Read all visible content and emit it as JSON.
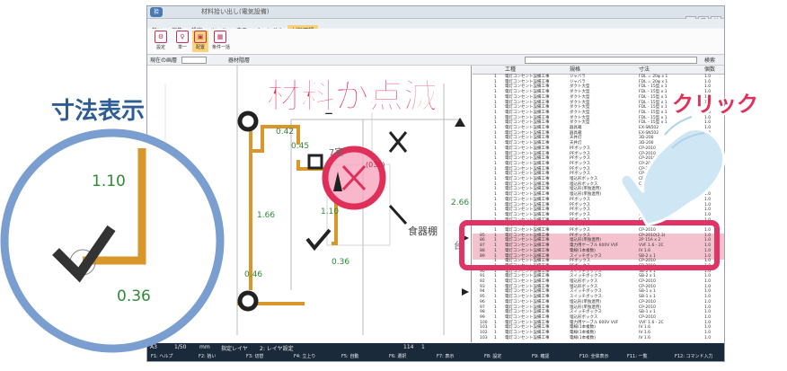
{
  "window": {
    "title": "材料拾い出し(電気設備)",
    "logo": "拾",
    "min_label": "_",
    "max_label": "□",
    "close_label": "×"
  },
  "menu": [
    "拾い",
    "編集",
    "設定",
    "ツール",
    "表示",
    "ウィンドウ",
    "材料確認"
  ],
  "ribbon": [
    {
      "label": "設定",
      "icon": "gear-icon",
      "glyph": "⚙"
    },
    {
      "label": "単一",
      "icon": "pin-icon",
      "glyph": "♀"
    },
    {
      "label": "配置",
      "icon": "place-icon",
      "glyph": "▣"
    },
    {
      "label": "条件一括",
      "icon": "filter-icon",
      "glyph": "▦"
    }
  ],
  "toolrow": {
    "layer_label": "現在の画層",
    "material_label": "器材階層",
    "search_label": "検索"
  },
  "drawing": {
    "dims": [
      "0.42",
      "0.45",
      "1.10",
      "0.36",
      "1.66",
      "0.46",
      "2.66"
    ],
    "room": "食器棚",
    "room_partial": "7室",
    "blink_label": "(030)",
    "kitchen_partial": "台"
  },
  "list": {
    "headers": [
      "工種",
      "規格",
      "寸法",
      "個数"
    ],
    "rows": [
      {
        "n": "",
        "q": "1",
        "trade": "電灯コンセント設備工事",
        "spec": "ジャバラ",
        "size": "FDL = 20φ x 1",
        "qty": "1.0",
        "hl": false
      },
      {
        "n": "",
        "q": "1",
        "trade": "電灯コンセント設備工事",
        "spec": "ジャバラ",
        "size": "FDL = 20φ x 1",
        "qty": "1.0",
        "hl": false
      },
      {
        "n": "",
        "q": "1",
        "trade": "電灯コンセント設備工事",
        "spec": "ダクト大型",
        "size": "FDL - 15型 x 1",
        "qty": "1.0",
        "hl": false
      },
      {
        "n": "",
        "q": "1",
        "trade": "電灯コンセント設備工事",
        "spec": "ダクト大型",
        "size": "FDL - 15型 x 1",
        "qty": "1.0",
        "hl": false
      },
      {
        "n": "",
        "q": "1",
        "trade": "電灯コンセント設備工事",
        "spec": "ダクト大型",
        "size": "FDL - 15型 x 1",
        "qty": "1.0",
        "hl": false
      },
      {
        "n": "",
        "q": "1",
        "trade": "電灯コンセント設備工事",
        "spec": "ダクト大型",
        "size": "FDL - 15型 x 1",
        "qty": "1.0",
        "hl": false
      },
      {
        "n": "",
        "q": "1",
        "trade": "電灯コンセント設備工事",
        "spec": "ダクト大型",
        "size": "FDL - 15型 x 1",
        "qty": "1.0",
        "hl": false
      },
      {
        "n": "",
        "q": "1",
        "trade": "電灯コンセント設備工事",
        "spec": "ダクト大型",
        "size": "FDL - 15型 x 1",
        "qty": "1.0",
        "hl": false
      },
      {
        "n": "",
        "q": "1",
        "trade": "電灯コンセント設備工事",
        "spec": "ダクト大型",
        "size": "FDL - 15型 x 1",
        "qty": "1.0",
        "hl": false
      },
      {
        "n": "",
        "q": "1",
        "trade": "電灯コンセント設備工事",
        "spec": "ダクト大型",
        "size": "FDL - 15型 x 1",
        "qty": "1.0",
        "hl": false
      },
      {
        "n": "",
        "q": "1",
        "trade": "電灯コンセント設備工事",
        "spec": "器具箱",
        "size": "EX-SN502",
        "qty": "1.0",
        "hl": false
      },
      {
        "n": "",
        "q": "1",
        "trade": "電灯コンセント設備工事",
        "spec": "器具箱",
        "size": "EX-SN502",
        "qty": "1.0",
        "hl": false
      },
      {
        "n": "",
        "q": "1",
        "trade": "電灯コンセント設備工事",
        "spec": "天井灯",
        "size": "3D-200",
        "qty": "1.0",
        "hl": false
      },
      {
        "n": "",
        "q": "1",
        "trade": "電灯コンセント設備工事",
        "spec": "天井灯",
        "size": "3D-200",
        "qty": "1.0",
        "hl": false
      },
      {
        "n": "",
        "q": "1",
        "trade": "電灯コンセント設備工事",
        "spec": "PFボックス",
        "size": "CP-2010",
        "qty": "1.0",
        "hl": false
      },
      {
        "n": "",
        "q": "1",
        "trade": "電灯コンセント設備工事",
        "spec": "PFボックス",
        "size": "CP-2010",
        "qty": "1.0",
        "hl": false
      },
      {
        "n": "",
        "q": "1",
        "trade": "電灯コンセント設備工事",
        "spec": "PFボックス",
        "size": "CP-2010",
        "qty": "1.0",
        "hl": false
      },
      {
        "n": "",
        "q": "1",
        "trade": "電灯コンセント設備工事",
        "spec": "PFボックス",
        "size": "CP-2010",
        "qty": "1.0",
        "hl": false
      },
      {
        "n": "",
        "q": "1",
        "trade": "電灯コンセント設備工事",
        "spec": "PFボックス",
        "size": "CP-2010",
        "qty": "1.0",
        "hl": false
      },
      {
        "n": "",
        "q": "1",
        "trade": "電灯コンセント設備工事",
        "spec": "PFボックス",
        "size": "CP-2010",
        "qty": "1.0",
        "hl": false
      },
      {
        "n": "",
        "q": "1",
        "trade": "電灯コンセント設備工事",
        "spec": "埋込形ボックス",
        "size": "CP-2010",
        "qty": "1.0",
        "hl": false
      },
      {
        "n": "",
        "q": "1",
        "trade": "電灯コンセント設備工事",
        "spec": "埋込形ボックス",
        "size": "CP-2010",
        "qty": "1.0",
        "hl": false
      },
      {
        "n": "",
        "q": "1",
        "trade": "電灯コンセント設備工事",
        "spec": "埋込形(単独連用)",
        "size": "CP-2010",
        "qty": "1.0",
        "hl": false
      },
      {
        "n": "",
        "q": "1",
        "trade": "電灯コンセント設備工事",
        "spec": "埋込形(単独連用)",
        "size": "CP-2010",
        "qty": "1.0",
        "hl": false
      },
      {
        "n": "",
        "q": "1",
        "trade": "電灯コンセント設備工事",
        "spec": "PFボックス",
        "size": "CP-2010",
        "qty": "1.0",
        "hl": false
      },
      {
        "n": "",
        "q": "1",
        "trade": "電灯コンセント設備工事",
        "spec": "PFボックス",
        "size": "CP-2010",
        "qty": "1.0",
        "hl": false
      },
      {
        "n": "",
        "q": "1",
        "trade": "電灯コンセント設備工事",
        "spec": "PFボックス",
        "size": "CP-2010",
        "qty": "1.0",
        "hl": false
      },
      {
        "n": "",
        "q": "1",
        "trade": "電灯コンセント設備工事",
        "spec": "PFボックス",
        "size": "CP-2010",
        "qty": "1.0",
        "hl": false
      },
      {
        "n": "",
        "q": "1",
        "trade": "電灯コンセント設備工事",
        "spec": "PFボックス",
        "size": "CP-2010",
        "qty": "1.0",
        "hl": false
      },
      {
        "n": "",
        "q": "1",
        "trade": "電灯コンセント設備工事",
        "spec": "PFボックス",
        "size": "CP-2010",
        "qty": "1.0",
        "hl": false
      },
      {
        "n": "",
        "q": "1",
        "trade": "電灯コンセント設備工事",
        "spec": "PFボックス",
        "size": "CP-2010",
        "qty": "1.0",
        "hl": false
      },
      {
        "n": "85",
        "q": "1",
        "trade": "電灯コンセント設備工事",
        "spec": "PFボックス",
        "size": "CP-2010(2.3)",
        "qty": "1.0",
        "hl": true
      },
      {
        "n": "86",
        "q": "1",
        "trade": "電灯コンセント設備工事",
        "spec": "埋込形(単独連用)",
        "size": "2P 15A x 2",
        "qty": "1.0",
        "hl": true
      },
      {
        "n": "87",
        "q": "1",
        "trade": "電灯コンセント設備工事",
        "spec": "電力用ケーブル 600V VVF",
        "size": "VVF 1.6 - 2C",
        "qty": "1.0",
        "hl": true
      },
      {
        "n": "88",
        "q": "1",
        "trade": "電灯コンセント設備工事",
        "spec": "電線(1本複数)",
        "size": "IV 1.6",
        "qty": "1.0",
        "hl": true
      },
      {
        "n": "89",
        "q": "1",
        "trade": "電灯コンセント設備工事",
        "spec": "スイッチボックス",
        "size": "SB-2 x 1",
        "qty": "1.0",
        "hl": true
      },
      {
        "n": "",
        "q": "1",
        "trade": "電灯コンセント設備工事",
        "spec": "PFボックス",
        "size": "CP-2010",
        "qty": "1.0",
        "hl": false
      },
      {
        "n": "",
        "q": "1",
        "trade": "電灯コンセント設備工事",
        "spec": "PFボックス",
        "size": "CP-2010",
        "qty": "1.0",
        "hl": false
      },
      {
        "n": "90",
        "q": "1",
        "trade": "電灯コンセント設備工事",
        "spec": "スイッチボックス",
        "size": "SB-2 x 1",
        "qty": "1.0",
        "hl": false
      },
      {
        "n": "91",
        "q": "1",
        "trade": "電灯コンセント設備工事",
        "spec": "スイッチボックス",
        "size": "SB-2 x 1",
        "qty": "1.0",
        "hl": false
      },
      {
        "n": "92",
        "q": "1",
        "trade": "電灯コンセント設備工事",
        "spec": "埋込形ボックス",
        "size": "CP-2010",
        "qty": "1.0",
        "hl": false
      },
      {
        "n": "93",
        "q": "1",
        "trade": "電灯コンセント設備工事",
        "spec": "埋込形ボックス",
        "size": "CP-2010",
        "qty": "1.0",
        "hl": false
      },
      {
        "n": "94",
        "q": "1",
        "trade": "電灯コンセント設備工事",
        "spec": "スイッチボックス",
        "size": "SB-1 x 1",
        "qty": "1.0",
        "hl": false
      },
      {
        "n": "95",
        "q": "1",
        "trade": "電灯コンセント設備工事",
        "spec": "スイッチボックス",
        "size": "SB-1 x 1",
        "qty": "1.0",
        "hl": false
      },
      {
        "n": "96",
        "q": "1",
        "trade": "電灯コンセント設備工事",
        "spec": "埋込形(単独連用)",
        "size": "CP-2010",
        "qty": "1.0",
        "hl": false
      },
      {
        "n": "97",
        "q": "1",
        "trade": "電灯コンセント設備工事",
        "spec": "埋込形(単独連用)",
        "size": "CP-2010",
        "qty": "1.0",
        "hl": false
      },
      {
        "n": "98",
        "q": "1",
        "trade": "電灯コンセント設備工事",
        "spec": "スイッチボックス",
        "size": "SB-1 x 1",
        "qty": "1.0",
        "hl": false
      },
      {
        "n": "99",
        "q": "1",
        "trade": "電灯コンセント設備工事",
        "spec": "埋込形ボックス",
        "size": "CP-2010",
        "qty": "1.0",
        "hl": false
      },
      {
        "n": "100",
        "q": "1",
        "trade": "電灯コンセント設備工事",
        "spec": "電力用ケーブル 600V VVF",
        "size": "VVF 1.6 - 2C",
        "qty": "1.0",
        "hl": false
      },
      {
        "n": "101",
        "q": "1",
        "trade": "電灯コンセント設備工事",
        "spec": "電線(1本複数)",
        "size": "IV 1.6",
        "qty": "1.0",
        "hl": false
      },
      {
        "n": "102",
        "q": "1",
        "trade": "電灯コンセント設備工事",
        "spec": "電線(1本複数)",
        "size": "IV 1.6",
        "qty": "1.0",
        "hl": false
      },
      {
        "n": "103",
        "q": "1",
        "trade": "電灯コンセント設備工事",
        "spec": "電線(1本複数)",
        "size": "IV 1.6",
        "qty": "1.0",
        "hl": false
      }
    ]
  },
  "statusbar": {
    "paper": "A3",
    "scale": "1/50",
    "unit": "mm",
    "layer_label": "指定レイヤ",
    "layer_set": "2: レイヤ設定",
    "keys": [
      "F1: ヘルプ",
      "F2: 拾い",
      "F3: 切替",
      "F4: 立上り",
      "F5: 自動",
      "F6: 選択",
      "F7: 表示",
      "F8: 設定",
      "F9: 確認",
      "F10: 全体表示",
      "F11: 一覧",
      "F12: コマンド入力"
    ],
    "counts": [
      "114",
      "1"
    ]
  },
  "annotations": {
    "dimension_title": "寸法表示",
    "zoom_dim_1": "1.10",
    "zoom_dim_2": "0.36",
    "blink_title": "材料が点滅",
    "click_label": "クリック"
  },
  "colors": {
    "wire": "#d9962a",
    "annotation_blue": "#2e5d93",
    "annotation_red": "#e0305a",
    "magnifier_ring": "#7a9ed0",
    "highlight_border": "#e03466",
    "dim_green": "#2f8a36"
  }
}
